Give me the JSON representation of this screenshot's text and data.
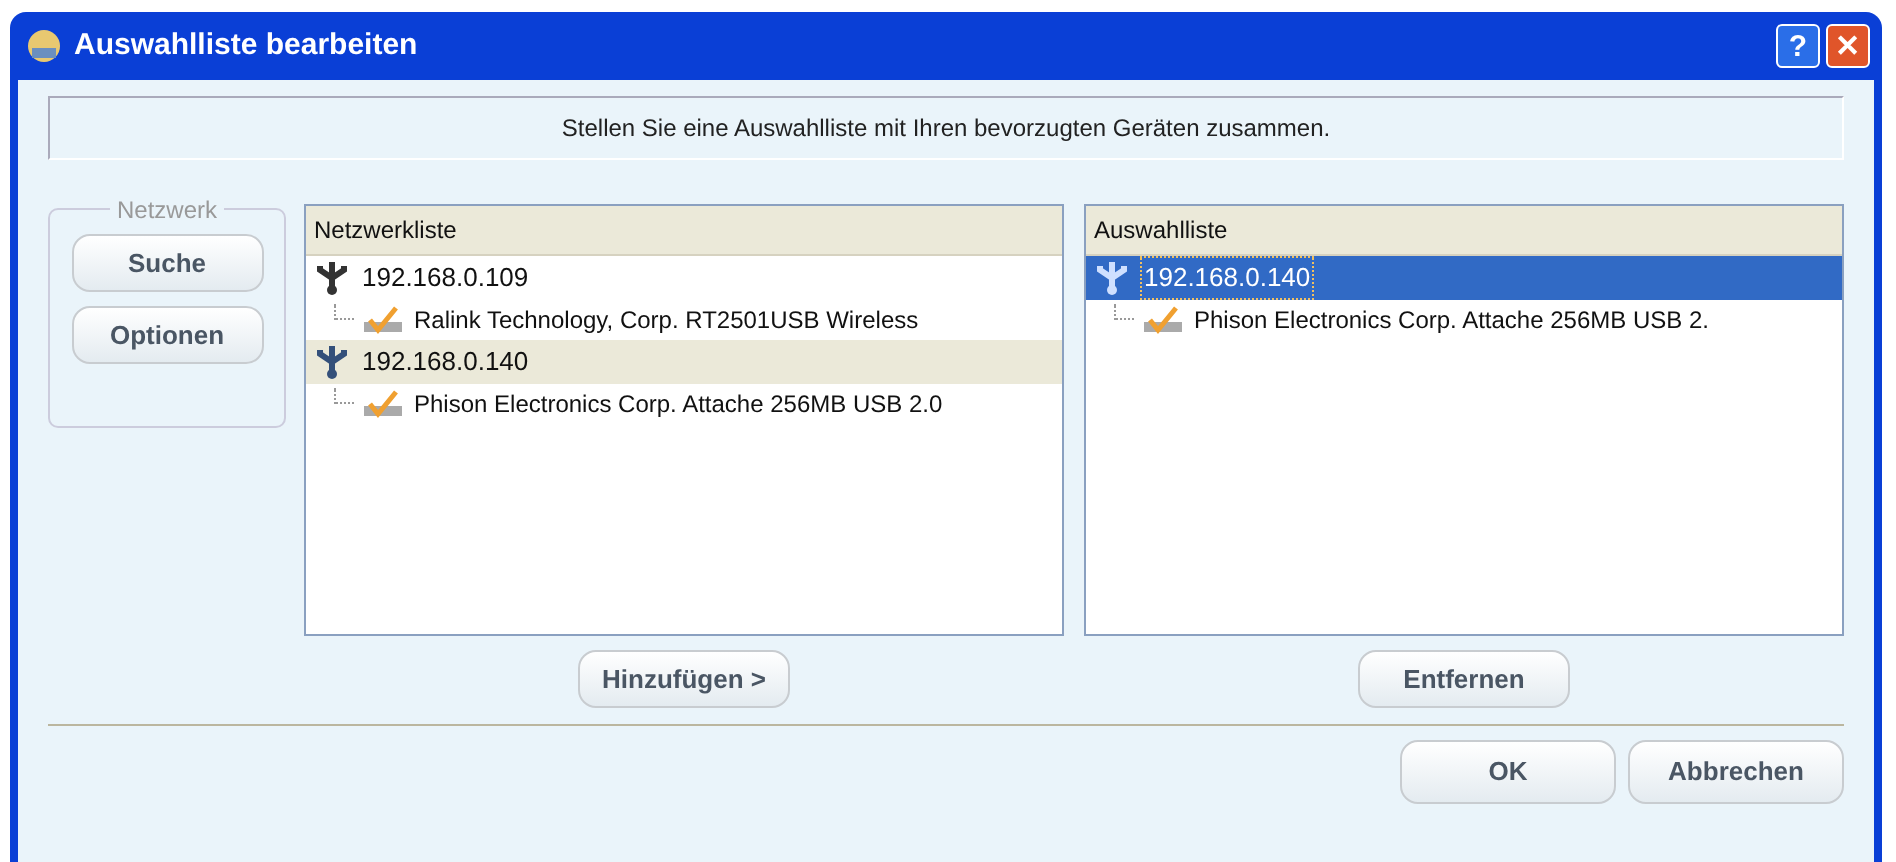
{
  "window": {
    "title": "Auswahlliste bearbeiten",
    "buttons": [
      "?",
      "✕"
    ]
  },
  "banner": "Stellen Sie eine Auswahlliste mit Ihren bevorzugten Geräten zusammen.",
  "network_group": {
    "title": "Netzwerk",
    "buttons": [
      "Suche",
      "Optionen"
    ]
  },
  "lists": [
    {
      "header": "Netzwerkliste",
      "focused": false,
      "button": "Hinzufügen >",
      "items": [
        {
          "label": "192.168.0.109",
          "selected": false,
          "children": [
            {
              "label": "Ralink Technology, Corp. RT2501USB Wireless",
              "selected": false
            }
          ]
        },
        {
          "label": "192.168.0.140",
          "selected": true,
          "children": [
            {
              "label": "Phison Electronics Corp. Attache 256MB USB 2.0",
              "selected": false
            }
          ]
        }
      ]
    },
    {
      "header": "Auswahlliste",
      "focused": true,
      "button": "Entfernen",
      "items": [
        {
          "label": "192.168.0.140",
          "selected": true,
          "children": [
            {
              "label": "Phison Electronics Corp. Attache 256MB USB 2.",
              "selected": false
            }
          ]
        }
      ]
    }
  ],
  "footer_buttons": [
    "OK",
    "Abbrechen"
  ]
}
